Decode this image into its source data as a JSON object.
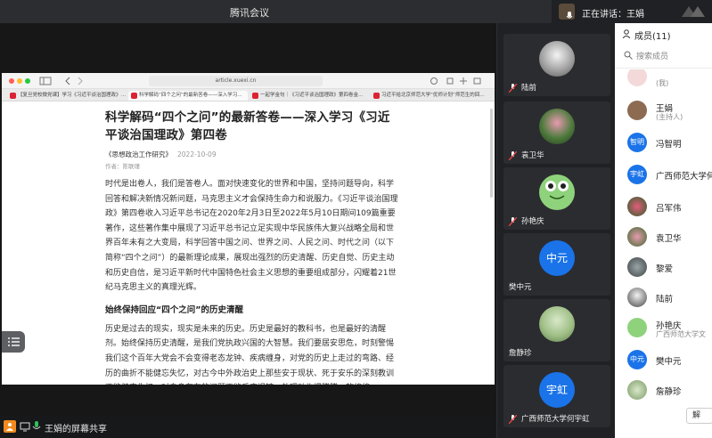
{
  "window": {
    "title": "腾讯会议",
    "speaking_label": "正在讲话：王娟"
  },
  "browser": {
    "url": "article.xuexi.cn",
    "tabs": [
      "【复旦党校微党课】学习《习近平谈治国理政》…",
      "科学解码“四个之问”的最新答卷——深入学习…",
      "一起学金句｜《习近平谈治国理政》第四卷金…",
      "习近平给北京师范大学“优师计划”师范生的回…"
    ]
  },
  "article": {
    "title": "科学解码“四个之问”的最新答卷——深入学习《习近平谈治国理政》第四卷",
    "source": "《思想政治工作研究》",
    "date": "2022-10-09",
    "author": "作者：陈联瑾",
    "para1": "时代是出卷人，我们是答卷人。面对快速变化的世界和中国，坚持问题导向，科学回答和解决新情况新问题，马克思主义才会保持生命力和说服力。《习近平谈治国理政》第四卷收入习近平总书记在2020年2月3日至2022年5月10日期间109篇重要著作，这些著作集中展现了习近平总书记立足实现中华民族伟大复兴战略全局和世界百年未有之大变局，科学回答中国之问、世界之问、人民之问、时代之问（以下简称“四个之问”）的最新理论成果，展现出强烈的历史清醒、历史自觉、历史主动和历史自信，是习近平新时代中国特色社会主义思想的重要组成部分，闪耀着21世纪马克思主义的真理光辉。",
    "heading2": "始终保持回应“四个之问”的历史清醒",
    "para2": "历史是过去的现实，现实是未来的历史。历史是最好的教科书，也是最好的清醒剂。始终保持历史清醒，是我们党执政兴国的大智慧。我们要居安思危，时刻警惕我们这个百年大党会不会变得老态龙钟、疾病缠身，对党的历史上走过的弯路、经历的曲折不能健忘失忆，对古今中外政治史上那些安于现状、死于安乐的深刻教训不能健忘失忆；对自身存在的问题不能反应迟钝，处理动作慢腾腾、软绵绵。"
  },
  "bottom_bar": {
    "share_label": "王娟的屏幕共享"
  },
  "video_tiles": [
    {
      "name": "陆前",
      "placeholder": ""
    },
    {
      "name": "袁卫华",
      "placeholder": ""
    },
    {
      "name": "孙艳庆",
      "placeholder": ""
    },
    {
      "name": "樊中元",
      "placeholder": "中元"
    },
    {
      "name": "詹静珍",
      "placeholder": ""
    },
    {
      "name": "广西师范大学何宇虹",
      "placeholder": "宇虹"
    }
  ],
  "members_panel": {
    "header": "成员(11)",
    "search_placeholder": "搜索成员",
    "members": [
      {
        "name": "",
        "sub": "(我)"
      },
      {
        "name": "王娟",
        "sub": "(主持人)"
      },
      {
        "name": "冯智明",
        "sub": "",
        "avatar_text": "智明"
      },
      {
        "name": "广西师范大学何",
        "sub": "",
        "avatar_text": "宇虹"
      },
      {
        "name": "吕军伟",
        "sub": ""
      },
      {
        "name": "袁卫华",
        "sub": ""
      },
      {
        "name": "黎爱",
        "sub": ""
      },
      {
        "name": "陆前",
        "sub": ""
      },
      {
        "name": "孙艳庆",
        "sub": "广西师范大学文"
      },
      {
        "name": "樊中元",
        "sub": "",
        "avatar_text": "中元"
      },
      {
        "name": "詹静珍",
        "sub": ""
      }
    ],
    "bottom_button": "解"
  }
}
